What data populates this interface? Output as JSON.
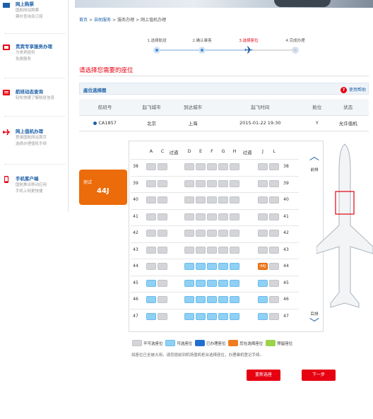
{
  "sidebar": {
    "items": [
      {
        "title": "网上购票",
        "sub1": "国航网站购票",
        "sub2": "票价查询及订座",
        "icon": "ticket-icon"
      },
      {
        "title": "贵宾专享服务办理",
        "sub1": "为贵宾提供",
        "sub2": "免费服务",
        "icon": "vip-icon"
      },
      {
        "title": "航班动态查询",
        "sub1": "轻松快捷了解航班信息",
        "sub2": "",
        "icon": "flight-status-icon"
      },
      {
        "title": "网上值机办理",
        "sub1": "登录国航网站首页",
        "sub2": "选择办理值机手续",
        "icon": "checkin-plane-icon"
      },
      {
        "title": "手机客户端",
        "sub1": "国航推出移动应用",
        "sub2": "手机上网更快捷",
        "icon": "mobile-icon"
      }
    ]
  },
  "breadcrumb": [
    "首页",
    ">",
    "自助服务",
    ">",
    "服务办理",
    ">",
    "网上值机办理"
  ],
  "steps": [
    {
      "label": "1.选择航班"
    },
    {
      "label": "2.确认乘客"
    },
    {
      "label": "3.选择座位"
    },
    {
      "label": "4.完成办理"
    }
  ],
  "prompt": "请选择您需要的座位",
  "panel": {
    "title": "座位选择图",
    "help": "使用帮助",
    "help_icon": "?"
  },
  "flight_table": {
    "headers": [
      "航班号",
      "起飞城市",
      "到达城市",
      "起飞时间",
      "舱位",
      "状态"
    ],
    "row": [
      "CA1857",
      "北京",
      "上海",
      "2015-01-22 19:30",
      "Y",
      "允许值机"
    ]
  },
  "seatmap": {
    "columns": [
      "A",
      "C",
      "过道",
      "D",
      "E",
      "F",
      "G",
      "H",
      "过道",
      "J",
      "L"
    ],
    "rows": [
      "38",
      "39",
      "40",
      "41",
      "42",
      "43",
      "44",
      "45",
      "46",
      "47"
    ],
    "front_label": "前排",
    "back_label": "后排",
    "selected_seat": "44J"
  },
  "passenger": {
    "name": "测试",
    "seat": "44J"
  },
  "legend": [
    "不可选座位",
    "可选座位",
    "已办理座位",
    "您在选择座位",
    "预留座位"
  ],
  "note": "如座位已全被占用，请您提前到机场值机柜台选择座位，办理乘机登记手续。",
  "buttons": {
    "reset": "重新选座",
    "next": "下一步"
  },
  "colors": {
    "brand": "#e60012",
    "link": "#1b5fa7",
    "free": "#8fd0f5",
    "occupied": "#d3d5d8",
    "selected": "#f07c1e"
  }
}
